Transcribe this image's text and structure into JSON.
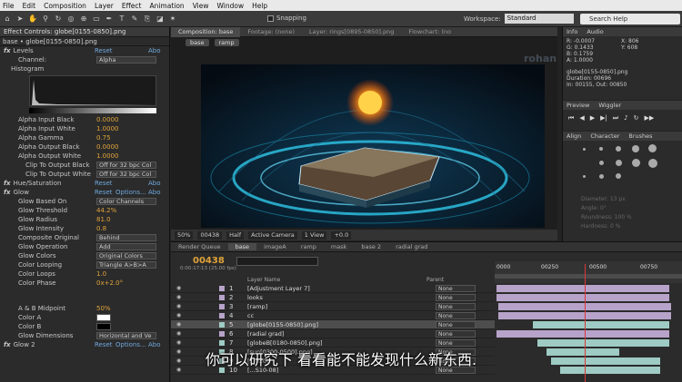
{
  "menu": [
    "File",
    "Edit",
    "Composition",
    "Layer",
    "Effect",
    "Animation",
    "View",
    "Window",
    "Help"
  ],
  "toolbar": {
    "snapping": "Snapping",
    "workspace_label": "Workspace:",
    "workspace_value": "Standard",
    "search_placeholder": "Search Help"
  },
  "effect_controls": {
    "tab": "Effect Controls: globe[0155-0850].png",
    "breadcrumb": "base • globe[0155-0850].png",
    "levels": {
      "name": "Levels",
      "reset": "Reset",
      "about": "Abo",
      "channel_label": "Channel:",
      "channel_value": "Alpha",
      "histogram": "Histogram"
    },
    "rows": [
      {
        "label": "Alpha Input Black",
        "value": "0.0000"
      },
      {
        "label": "Alpha Input White",
        "value": "1.0000"
      },
      {
        "label": "Alpha Gamma",
        "value": "0.75"
      },
      {
        "label": "Alpha Output Black",
        "value": "0.0000"
      },
      {
        "label": "Alpha Output White",
        "value": "1.0000"
      }
    ],
    "clip_rows": [
      {
        "label": "Clip To Output Black",
        "value": "Off for 32 bpc Col"
      },
      {
        "label": "Clip To Output White",
        "value": "Off for 32 bpc Col"
      }
    ],
    "hue": {
      "name": "Hue/Saturation",
      "reset": "Reset",
      "about": "Abo"
    },
    "glow": {
      "name": "Glow",
      "reset": "Reset",
      "options": "Options...",
      "about": "Abo"
    },
    "glow_rows": [
      {
        "label": "Glow Based On",
        "value": "Color Channels",
        "kind": "select"
      },
      {
        "label": "Glow Threshold",
        "value": "44.2%",
        "kind": "value"
      },
      {
        "label": "Glow Radius",
        "value": "81.0",
        "kind": "value"
      },
      {
        "label": "Glow Intensity",
        "value": "0.8",
        "kind": "value"
      },
      {
        "label": "Composite Original",
        "value": "Behind",
        "kind": "select"
      },
      {
        "label": "Glow Operation",
        "value": "Add",
        "kind": "select"
      },
      {
        "label": "Glow Colors",
        "value": "Original Colors",
        "kind": "select"
      },
      {
        "label": "Color Looping",
        "value": "Triangle A>B>A",
        "kind": "select"
      },
      {
        "label": "Color Loops",
        "value": "1.0",
        "kind": "value"
      },
      {
        "label": "Color Phase",
        "value": "0x+2.0°",
        "kind": "value"
      }
    ],
    "glow_rows2": [
      {
        "label": "A & B Midpoint",
        "value": "50%",
        "kind": "value"
      },
      {
        "label": "Color A",
        "value": "",
        "kind": "color"
      },
      {
        "label": "Color B",
        "value": "",
        "kind": "color"
      },
      {
        "label": "Glow Dimensions",
        "value": "Horizontal and Ve",
        "kind": "select"
      }
    ],
    "glow2": {
      "name": "Glow 2",
      "reset": "Reset",
      "options": "Options...",
      "about": "Abo"
    }
  },
  "composition": {
    "tabs": [
      "Composition: base",
      "Footage: (none)",
      "Layer: rings[0895-0850].png",
      "Flowchart: (no"
    ],
    "crumbs": [
      "base",
      "ramp"
    ],
    "watermark": "rohan",
    "viewbar": [
      "50%",
      "00438",
      "Half",
      "Active Camera",
      "1 View",
      "+0.0"
    ]
  },
  "info": {
    "tabs": [
      "Info",
      "Audio"
    ],
    "lines": [
      "R: -0.0007",
      "G: 0.1433",
      "B: 0.1759",
      "A: 1.0000",
      "X: 806",
      "Y: 608"
    ],
    "file": [
      "globe[0155-0850].png",
      "Duration: 00696",
      "In: 00155, Out: 00850"
    ]
  },
  "preview": {
    "tabs": [
      "Preview",
      "Wiggler"
    ]
  },
  "brushes": {
    "tabs": [
      "Align",
      "Character",
      "Brushes"
    ],
    "labels": [
      "Diameter: 13 px",
      "Angle: 0°",
      "Roundness: 100 %",
      "Hardness: 0 %"
    ]
  },
  "timeline": {
    "tabs": [
      "Render Queue",
      "base",
      "imageA",
      "ramp",
      "mask",
      "base 2",
      "radial grad"
    ],
    "timecode": "00438",
    "timecode_sub": "0:00:17:13 (25.00 fps)",
    "columns": {
      "layer_name": "Layer Name",
      "parent": "Parent"
    },
    "ruler": [
      "0000",
      "00250",
      "00500",
      "00750"
    ],
    "layers": [
      {
        "num": "1",
        "name": "[Adjustment Layer 7]",
        "parent": "None",
        "color": "#b7a3c9"
      },
      {
        "num": "2",
        "name": "looks",
        "parent": "None",
        "color": "#b7a3c9"
      },
      {
        "num": "3",
        "name": "[ramp]",
        "parent": "None",
        "color": "#b7a3c9"
      },
      {
        "num": "4",
        "name": "cc",
        "parent": "None",
        "color": "#b7a3c9"
      },
      {
        "num": "5",
        "name": "[globe[0155-0850].png]",
        "parent": "None",
        "color": "#9ecbc4"
      },
      {
        "num": "6",
        "name": "[radial grad]",
        "parent": "None",
        "color": "#b7a3c9"
      },
      {
        "num": "7",
        "name": "[globeB[0180-0850].png]",
        "parent": "None",
        "color": "#9ecbc4"
      },
      {
        "num": "8",
        "name": "[sun[0300-0500].png]",
        "parent": "None",
        "color": "#9ecbc4"
      },
      {
        "num": "9",
        "name": "[...0200",
        "parent": "None",
        "color": "#9ecbc4"
      },
      {
        "num": "10",
        "name": "[...S10-08]",
        "parent": "None",
        "color": "#9ecbc4"
      }
    ]
  },
  "subtitle": "你可以研究下 看看能不能发现什么新东西."
}
